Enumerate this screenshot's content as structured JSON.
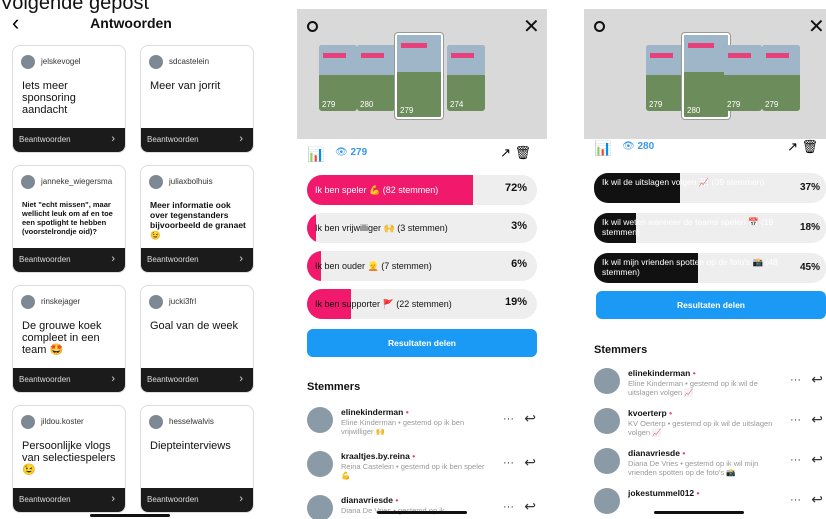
{
  "caption": "Volgende gepost",
  "panel1": {
    "title": "Antwoorden",
    "reply_label": "Beantwoorden",
    "cards": [
      {
        "user": "jelskevogel",
        "question": "Iets meer sponsoring aandacht",
        "size": "normal"
      },
      {
        "user": "sdcastelein",
        "question": "Meer van jorrit",
        "size": "normal"
      },
      {
        "user": "janneke_wiegersma",
        "question": "Niet \"echt missen\", maar wellicht leuk om af en toe een spotlight te hebben (voorstelrondje oid)?",
        "size": "small"
      },
      {
        "user": "juliaxbolhuis",
        "question": "Meer informatie ook over tegenstanders bijvoorbeeld de granaet😉",
        "size": "mid"
      },
      {
        "user": "rinskejager",
        "question": "De grouwe koek compleet in een team 🤩",
        "size": "normal"
      },
      {
        "user": "jucki3frl",
        "question": "Goal van de week",
        "size": "normal"
      },
      {
        "user": "jildou.koster",
        "question": "Persoonlijke vlogs van selectiespelers 😉",
        "size": "normal"
      },
      {
        "user": "hesselwalvis",
        "question": "Diepteinterviews",
        "size": "normal"
      }
    ]
  },
  "panel2": {
    "thumb_counts": [
      "279",
      "280",
      "279",
      "274"
    ],
    "selected_count": "279",
    "views": "279",
    "poll": [
      {
        "label": "Ik ben speler 💪 (82 stemmen)",
        "percent": 72,
        "pct_label": "72%"
      },
      {
        "label": "Ik ben vrijwilliger 🙌 (3 stemmen)",
        "percent": 3,
        "pct_label": "3%"
      },
      {
        "label": "Ik ben ouder 👱 (7 stemmen)",
        "percent": 6,
        "pct_label": "6%"
      },
      {
        "label": "Ik ben supporter 🚩 (22 stemmen)",
        "percent": 19,
        "pct_label": "19%"
      }
    ],
    "share_label": "Resultaten delen",
    "voters_title": "Stemmers",
    "voters": [
      {
        "handle": "elinekinderman",
        "detail": "Eline Kinderman • gestemd op ik ben vrijwilliger 🙌"
      },
      {
        "handle": "kraaltjes.by.reina",
        "detail": "Reina Castelein • gestemd op ik ben speler 💪"
      },
      {
        "handle": "dianavriesde",
        "detail": "Diana De Vries • gestemd op ik"
      }
    ]
  },
  "panel3": {
    "thumb_counts": [
      "279",
      "280",
      "279",
      "279"
    ],
    "views": "280",
    "poll": [
      {
        "label": "Ik wil de uitslagen volgen 📈 (39 stemmen)",
        "percent": 37,
        "pct_label": "37%"
      },
      {
        "label": "Ik wil weten wanneer de teams spelen 📅 (19 stemmen)",
        "percent": 18,
        "pct_label": "18%"
      },
      {
        "label": "Ik wil mijn vrienden spotten op de foto's 📸 (48 stemmen)",
        "percent": 45,
        "pct_label": "45%"
      }
    ],
    "share_label": "Resultaten delen",
    "voters_title": "Stemmers",
    "voters": [
      {
        "handle": "elinekinderman",
        "detail": "Eline Kinderman • gestemd op ik wil de uitslagen volgen 📈"
      },
      {
        "handle": "kvoerterp",
        "detail": "KV Oerterp • gestemd op ik wil de uitslagen volgen 📈"
      },
      {
        "handle": "dianavriesde",
        "detail": "Diana De Vries • gestemd op ik wil mijn vrienden spotten op de foto's 📸"
      },
      {
        "handle": "jokestummel012",
        "detail": ""
      }
    ]
  },
  "colors": {
    "accent_pink": "#f0196b",
    "accent_blue": "#1a9af5",
    "dark": "#111111"
  }
}
